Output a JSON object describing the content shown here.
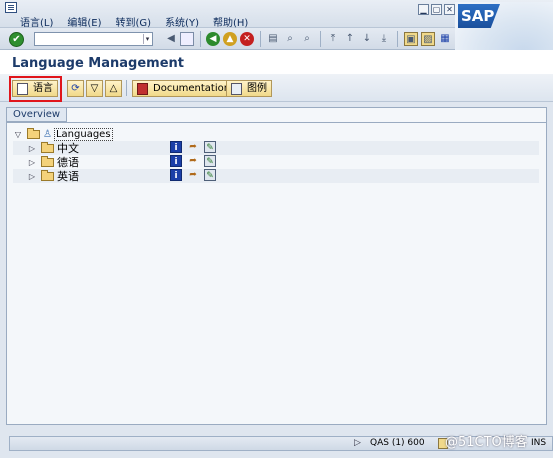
{
  "menubar": {
    "items": [
      "语言(L)",
      "编辑(E)",
      "转到(G)",
      "系统(Y)",
      "帮助(H)"
    ],
    "window_controls": [
      "▁",
      "▢",
      "✕"
    ]
  },
  "sap_logo": "SAP",
  "standard_toolbar": {
    "command_field": "",
    "icons": [
      "enter-icon",
      "save-icon",
      "back-icon",
      "exit-icon",
      "cancel-icon",
      "print-icon",
      "find-icon",
      "find-next-icon",
      "first-page-icon",
      "previous-page-icon",
      "next-page-icon",
      "last-page-icon",
      "new-session-icon",
      "shortcut-icon",
      "help-icon",
      "layout-menu-icon"
    ]
  },
  "title": "Language Management",
  "app_toolbar": {
    "language_button": "语言",
    "documentation_button": "Documentation",
    "legend_button": "图例"
  },
  "overview": {
    "tab_label": "Overview",
    "root_label": "Languages",
    "languages": [
      {
        "label": "中文"
      },
      {
        "label": "德语"
      },
      {
        "label": "英语"
      }
    ]
  },
  "statusbar": {
    "system": "QAS (1) 600",
    "host": "",
    "mode": "INS"
  },
  "watermark": "@51CTO博客",
  "colors": {
    "highlight": "#e0151b",
    "sap_blue": "#1a4f9c",
    "button_gold": "#f1d98a"
  }
}
